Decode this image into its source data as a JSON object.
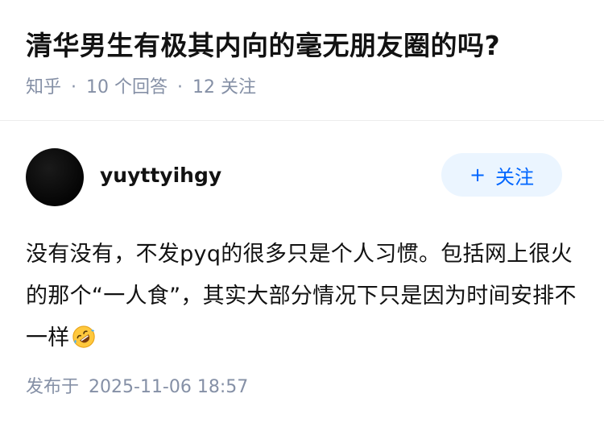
{
  "question": {
    "title": "清华男生有极其内向的毫无朋友圈的吗?",
    "source": "知乎",
    "separator": "·",
    "answer_count": "10  个回答",
    "follower_count": "12  关注"
  },
  "answer": {
    "author": "yuyttyihgy",
    "follow_label": "关注",
    "follow_icon": "+",
    "body": "没有没有，不发pyq的很多只是个人习惯。包括网上很火的那个“一人食”，其实大部分情况下只是因为时间安排不一样",
    "emoji_icon": "rolling-on-floor-laughing-icon",
    "published_label": "发布于",
    "published_time": "2025-11-06 18:57"
  },
  "colors": {
    "accent": "#0066ff",
    "accent_bg": "#ebf5ff",
    "meta_text": "#8590a6",
    "primary_text": "#121212"
  }
}
